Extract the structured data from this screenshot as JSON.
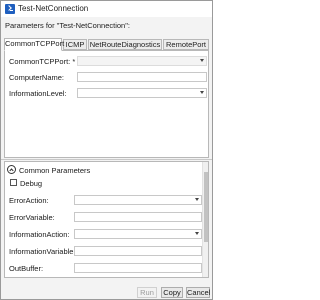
{
  "window": {
    "title": "Test-NetConnection"
  },
  "header": {
    "params_for": "Parameters for \"Test-NetConnection\":"
  },
  "tabs": [
    {
      "label": "CommonTCPPort",
      "active": true
    },
    {
      "label": "ICMP",
      "active": false
    },
    {
      "label": "NetRouteDiagnostics",
      "active": false
    },
    {
      "label": "RemotePort",
      "active": false
    }
  ],
  "tcp_params": {
    "common_tcp_port": {
      "label": "CommonTCPPort: *",
      "value": ""
    },
    "computer_name": {
      "label": "ComputerName:",
      "value": ""
    },
    "information_level": {
      "label": "InformationLevel:",
      "value": ""
    }
  },
  "common": {
    "title": "Common Parameters",
    "debug_label": "Debug",
    "debug_checked": false,
    "fields": [
      {
        "label": "ErrorAction:",
        "type": "combo",
        "value": ""
      },
      {
        "label": "ErrorVariable:",
        "type": "text",
        "value": ""
      },
      {
        "label": "InformationAction:",
        "type": "combo",
        "value": ""
      },
      {
        "label": "InformationVariable:",
        "type": "text",
        "value": ""
      },
      {
        "label": "OutBuffer:",
        "type": "text",
        "value": ""
      }
    ]
  },
  "buttons": {
    "run": "Run",
    "copy": "Copy",
    "cancel": "Cancel"
  },
  "colors": {
    "ps_icon": "#1f5fbf"
  }
}
